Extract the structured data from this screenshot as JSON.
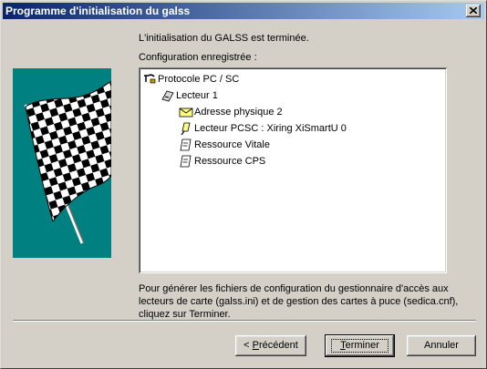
{
  "window": {
    "title": "Programme d'initialisation du galss"
  },
  "main": {
    "status_text": "L'initialisation du GALSS est terminée.",
    "config_label": "Configuration enregistrée :"
  },
  "tree": {
    "root": {
      "label": "Protocole PC / SC",
      "icon": "protocol-icon"
    },
    "reader": {
      "label": "Lecteur 1",
      "icon": "card-reader-icon"
    },
    "children": [
      {
        "label": "Adresse physique 2",
        "icon": "envelope-icon"
      },
      {
        "label": "Lecteur PCSC : Xiring XiSmartU 0",
        "icon": "pcsc-reader-icon"
      },
      {
        "label": "Ressource Vitale",
        "icon": "card-resource-icon"
      },
      {
        "label": "Ressource CPS",
        "icon": "card-resource-icon"
      }
    ]
  },
  "description": "Pour générer les fichiers de configuration du gestionnaire d'accès aux lecteurs de carte (galss.ini) et de gestion des cartes à puce (sedica.cnf), cliquez sur Terminer.",
  "buttons": {
    "back": {
      "prefix": "< ",
      "mnemonic": "P",
      "rest": "récédent"
    },
    "finish": {
      "mnemonic": "T",
      "rest": "erminer"
    },
    "cancel": {
      "label": "Annuler"
    }
  },
  "colors": {
    "titlebar_start": "#0a246a",
    "titlebar_end": "#a6caf0",
    "banner": "#008080",
    "face": "#d4d0c8"
  }
}
